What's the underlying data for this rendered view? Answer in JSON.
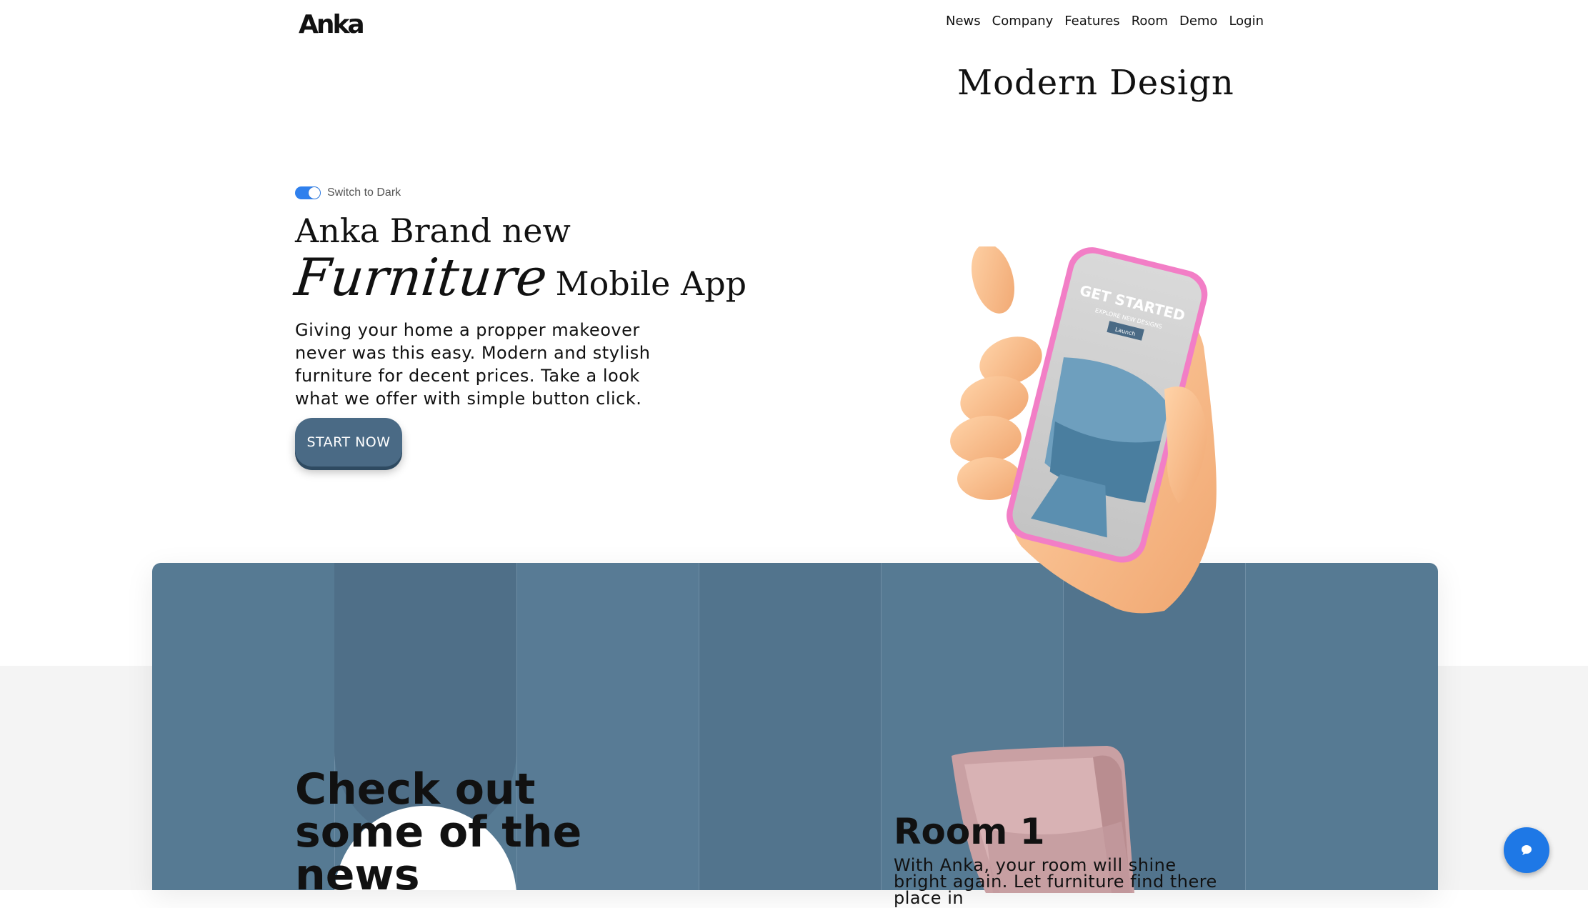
{
  "header": {
    "logo_text": "Anka",
    "nav": [
      "News",
      "Company",
      "Features",
      "Room",
      "Demo",
      "Login"
    ],
    "tagline": "Modern Design"
  },
  "hero": {
    "toggle_label": "Switch to Dark",
    "toggle_on": true,
    "headline_line1": "Anka Brand new",
    "headline_script": "Furniture",
    "headline_suffix": "Mobile App",
    "paragraph": "Giving your home a propper makeover never was this easy. Modern and stylish furniture for decent prices. Take a look what we offer with simple button click.",
    "cta_label": "START NOW",
    "phone_screen": {
      "title": "GET STARTED",
      "subtitle": "EXPLORE NEW DESIGNS",
      "button": "Launch"
    }
  },
  "panel": {
    "news_heading": "Check out some of the news",
    "room_title": "Room 1",
    "room_description": "With Anka, your room will shine bright again. Let furniture find there place in"
  },
  "colors": {
    "panel_blue": "#567a93",
    "panel_blue_dark": "#4f6f88",
    "accent_blue": "#1e78e6",
    "cta_blue": "#4a6a85",
    "toggle_blue": "#2f80ed"
  },
  "icons": {
    "chat": "chat-bubble-icon",
    "toggle": "toggle-switch-icon"
  }
}
